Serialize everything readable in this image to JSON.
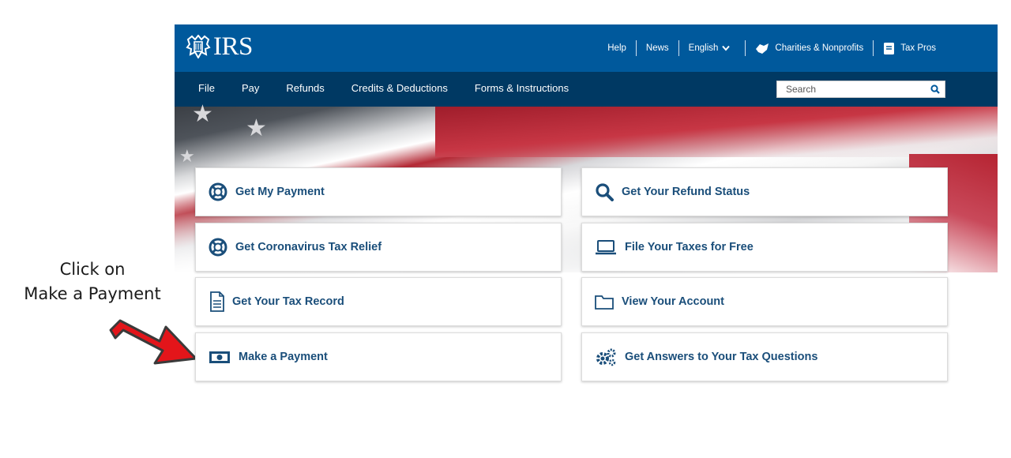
{
  "annotation": {
    "line1": "Click on",
    "line2": "Make a Payment",
    "arrow_color": "#e3151a"
  },
  "brand": {
    "logo_text": "IRS",
    "logo_icon": "eagle-icon",
    "primary_color": "#00599c",
    "nav_color": "#003963"
  },
  "utility_nav": {
    "help": "Help",
    "news": "News",
    "language": "English",
    "charities": "Charities & Nonprofits",
    "tax_pros": "Tax Pros"
  },
  "main_nav": [
    "File",
    "Pay",
    "Refunds",
    "Credits & Deductions",
    "Forms & Instructions"
  ],
  "search": {
    "placeholder": "Search"
  },
  "tiles": [
    {
      "label": "Get My Payment",
      "icon": "lifebuoy-icon"
    },
    {
      "label": "Get Your Refund Status",
      "icon": "search-icon"
    },
    {
      "label": "Get Coronavirus Tax Relief",
      "icon": "lifebuoy-icon"
    },
    {
      "label": "File Your Taxes for Free",
      "icon": "laptop-icon"
    },
    {
      "label": "Get Your Tax Record",
      "icon": "document-icon"
    },
    {
      "label": "View Your Account",
      "icon": "folder-icon"
    },
    {
      "label": "Make a Payment",
      "icon": "money-icon"
    },
    {
      "label": "Get Answers to Your Tax Questions",
      "icon": "gears-icon"
    }
  ]
}
